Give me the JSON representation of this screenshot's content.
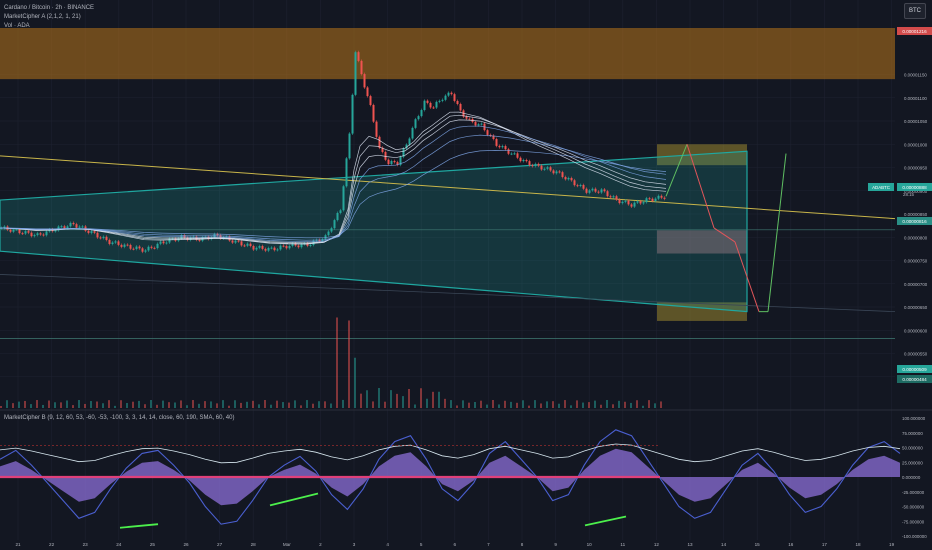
{
  "header": {
    "symbol_line": "Cardano / Bitcoin · 2h · BINANCE",
    "indicator_a": "MarketCipher A (2,1,2, 1, 21)",
    "volume_label": "Vol · ADA",
    "indicator_b": "MarketCipher B (9, 12, 60, 53, -60, -53, -100, 3, 3, 14, 14, close, 60, 190, SMA, 60, 40)",
    "currency_button": "BTC"
  },
  "colors": {
    "background": "#131722",
    "up": "#26a69a",
    "down": "#ef5350",
    "supply_zone": "#b8741a",
    "channel": "#1fa7a0",
    "trendline": "#c8b54a",
    "projection_up": "#5fbf62",
    "projection_down": "#e0555a",
    "wave_purple": "#8c6fd8",
    "wave_yellow": "#e8d43c",
    "divergence": "#4cf04c"
  },
  "chart_data": [
    {
      "type": "candlestick",
      "title": "Cardano / Bitcoin · 2h · BINANCE",
      "x_ticks": [
        "21",
        "22",
        "23",
        "24",
        "25",
        "26",
        "27",
        "28",
        "Mar",
        "2",
        "3",
        "4",
        "5",
        "6",
        "7",
        "8",
        "9",
        "10",
        "11",
        "12",
        "13",
        "14",
        "15",
        "16",
        "17",
        "18",
        "19"
      ],
      "y_ticks": [
        "0.00001150",
        "0.00001100",
        "0.00001050",
        "0.00001000",
        "0.00000950",
        "0.00000900",
        "0.00000850",
        "0.00000800",
        "0.00000750",
        "0.00000700",
        "0.00000650",
        "0.00000600",
        "0.00000550",
        "0.00000500"
      ],
      "ylim": [
        4.5e-06,
        1.25e-05
      ],
      "price_labels": {
        "top": "0.00001216",
        "current": "0.00000888",
        "current_sub": "28:15",
        "symbol_tag": "ADABTC",
        "line": "0.00000816",
        "vol_1": "0.00000509",
        "vol_2": "0.00000484"
      },
      "zones": [
        {
          "name": "supply",
          "from": 1.14e-05,
          "to": 1.25e-05
        },
        {
          "name": "target-high",
          "from": 9.55e-06,
          "to": 1e-05
        },
        {
          "name": "target-mid",
          "from": 7.65e-06,
          "to": 8.15e-06
        },
        {
          "name": "target-low",
          "from": 6.2e-06,
          "to": 6.6e-06
        }
      ],
      "close_path": [
        [
          0,
          8.2e-06
        ],
        [
          6,
          8.12e-06
        ],
        [
          12,
          8.04e-06
        ],
        [
          18,
          8.18e-06
        ],
        [
          24,
          8.28e-06
        ],
        [
          30,
          8.1e-06
        ],
        [
          36,
          7.9e-06
        ],
        [
          42,
          7.8e-06
        ],
        [
          48,
          7.72e-06
        ],
        [
          54,
          7.9e-06
        ],
        [
          60,
          8e-06
        ],
        [
          66,
          7.96e-06
        ],
        [
          72,
          8.04e-06
        ],
        [
          78,
          7.9e-06
        ],
        [
          84,
          7.78e-06
        ],
        [
          90,
          7.74e-06
        ],
        [
          96,
          7.82e-06
        ],
        [
          102,
          7.84e-06
        ],
        [
          108,
          8e-06
        ],
        [
          113,
          8.6e-06
        ],
        [
          116,
          1.02e-05
        ],
        [
          118,
          1.2e-05
        ],
        [
          120,
          1.15e-05
        ],
        [
          123,
          1.08e-05
        ],
        [
          126,
          9.9e-06
        ],
        [
          129,
          9.6e-06
        ],
        [
          132,
          9.6e-06
        ],
        [
          135,
          1e-05
        ],
        [
          138,
          1.05e-05
        ],
        [
          141,
          1.09e-05
        ],
        [
          144,
          1.08e-05
        ],
        [
          147,
          1.1e-05
        ],
        [
          150,
          1.11e-05
        ],
        [
          153,
          1.07e-05
        ],
        [
          156,
          1.05e-05
        ],
        [
          160,
          1.04e-05
        ],
        [
          165,
          1e-05
        ],
        [
          170,
          9.8e-06
        ],
        [
          175,
          9.6e-06
        ],
        [
          180,
          9.5e-06
        ],
        [
          185,
          9.4e-06
        ],
        [
          190,
          9.2e-06
        ],
        [
          195,
          9e-06
        ],
        [
          200,
          9e-06
        ],
        [
          205,
          8.8e-06
        ],
        [
          210,
          8.7e-06
        ],
        [
          215,
          8.8e-06
        ],
        [
          222,
          8.88e-06
        ]
      ],
      "projection": [
        [
          222,
          8.88e-06
        ],
        [
          229,
          1e-05
        ],
        [
          238,
          8.2e-06
        ],
        [
          245,
          7.9e-06
        ],
        [
          253,
          6.4e-06
        ],
        [
          256,
          6.4e-06
        ],
        [
          262,
          9.8e-06
        ]
      ],
      "volume": "spike near 2 Mar, low elsewhere"
    },
    {
      "type": "line",
      "title": "MarketCipher B (9, 12, 60, 53, -60, -53, -100, 3, 3, 14, 14, close, 60, 190, SMA, 60, 40)",
      "y_ticks": [
        "100.000000",
        "75.000000",
        "50.000000",
        "25.000000",
        "0.000000",
        "-25.000000",
        "-50.000000",
        "-75.000000",
        "-100.000000"
      ],
      "ylim": [
        -100,
        100
      ],
      "series": [
        {
          "name": "",
          "values": [
            30,
            45,
            20,
            -10,
            -40,
            -70,
            -60,
            -20,
            15,
            40,
            45,
            20,
            -10,
            -50,
            -80,
            -75,
            -40,
            0,
            20,
            35,
            10,
            -30,
            -55,
            -20,
            30,
            60,
            70,
            30,
            -20,
            -40,
            -10,
            40,
            60,
            30,
            0,
            -40,
            -30,
            20,
            60,
            80,
            70,
            30,
            -10,
            -50,
            -70,
            -60,
            -20,
            20,
            40,
            10,
            -30,
            -60,
            -50,
            -20,
            20,
            50,
            60,
            40
          ]
        }
      ]
    }
  ]
}
